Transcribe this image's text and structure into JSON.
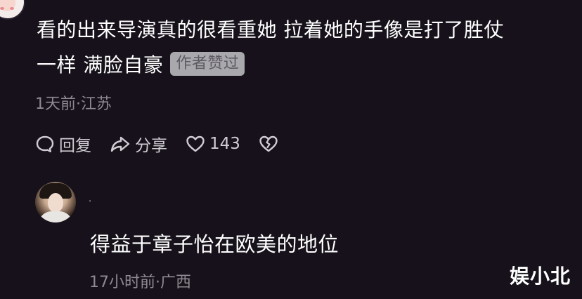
{
  "comment": {
    "text_line1": "看的出来导演真的很看重她 拉着她的手像是打了胜仗",
    "text_line2": "一样 满脸自豪",
    "author_liked_badge": "作者赞过",
    "meta": "1天前·江苏",
    "actions": {
      "reply_label": "回复",
      "share_label": "分享",
      "like_count": "143"
    }
  },
  "reply": {
    "username": "ᐝ",
    "text": "得益于章子怡在欧美的地位",
    "meta": "17小时前·广西"
  },
  "watermark": "娱小北",
  "colors": {
    "background": "#16111a",
    "text": "#ffffff",
    "meta": "#8d8a92",
    "badge_bg": "#a9a8ad"
  }
}
